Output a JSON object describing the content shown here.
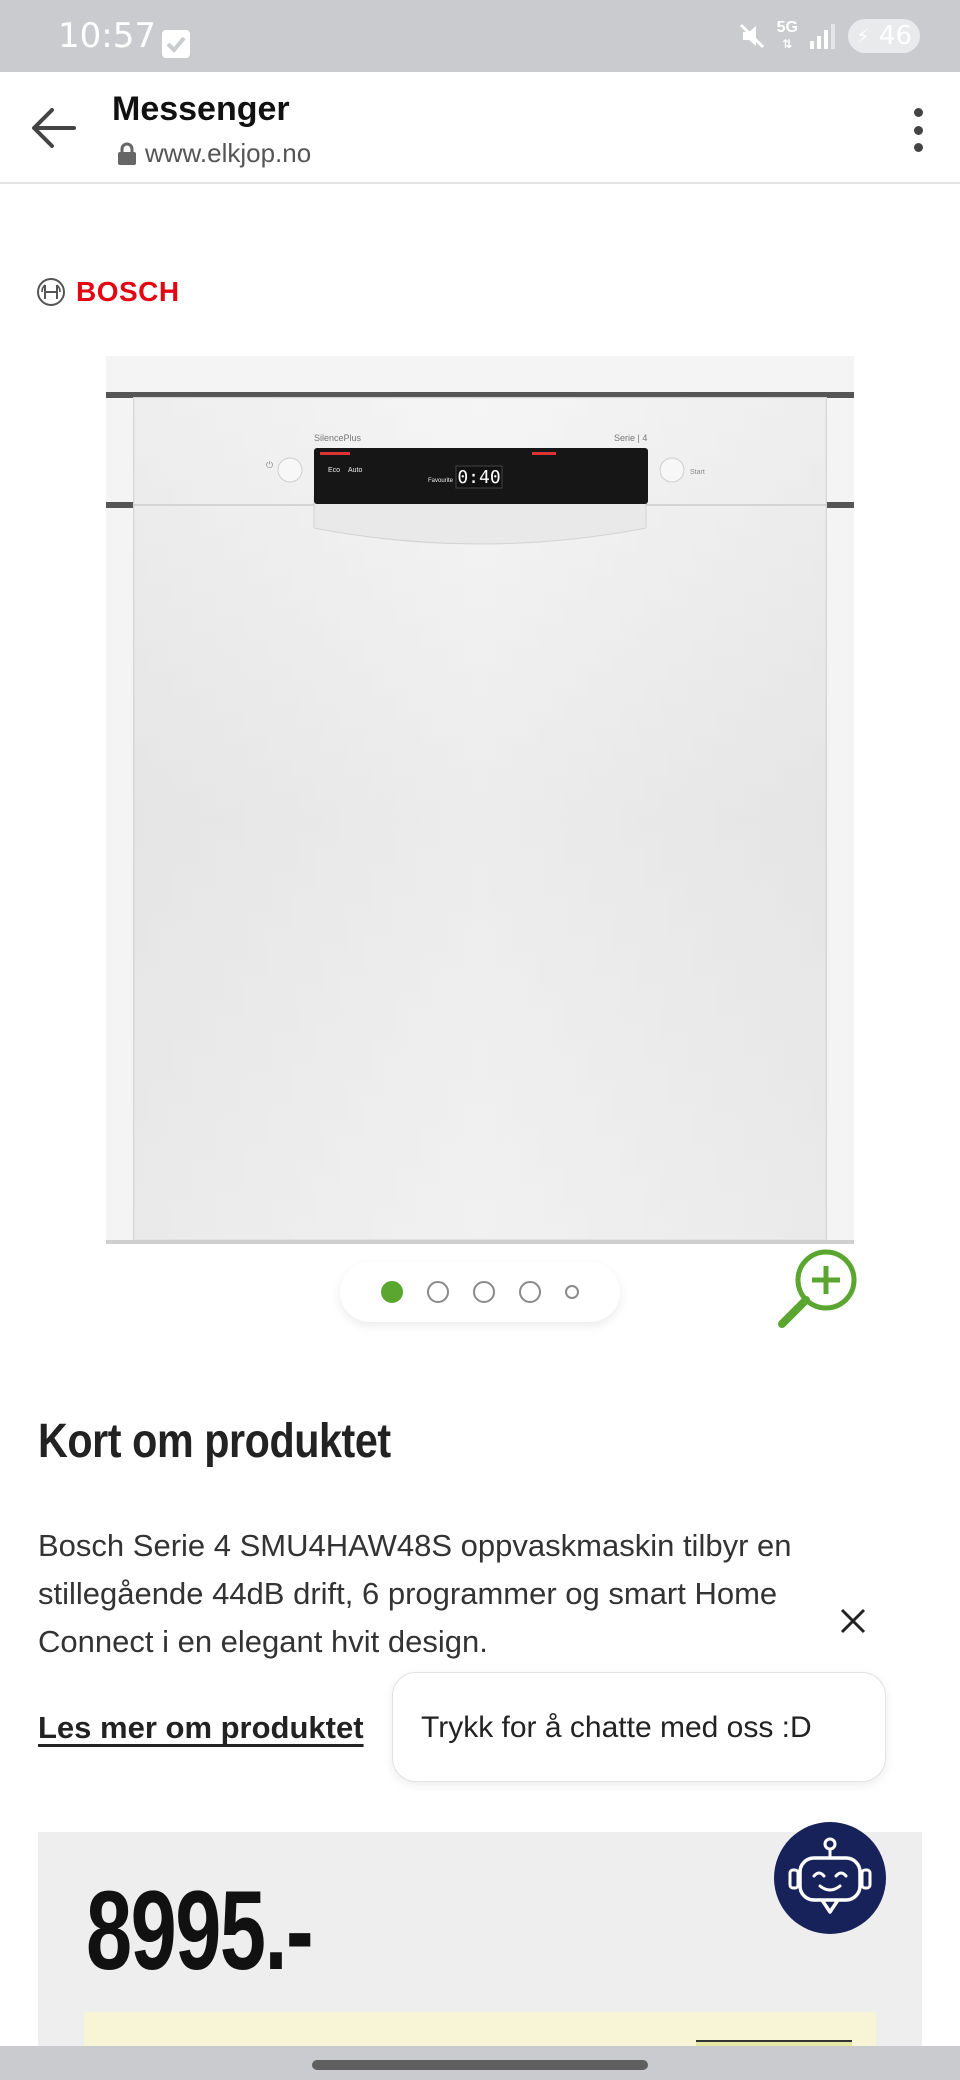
{
  "status_bar": {
    "time": "10:57",
    "network": "5G",
    "battery": "46",
    "icons": [
      "checkbox-notification-icon",
      "mute-icon",
      "signal-icon",
      "battery-saver-icon"
    ]
  },
  "browser": {
    "title": "Messenger",
    "url": "www.elkjop.no",
    "icons": [
      "back-arrow-icon",
      "lock-icon",
      "more-vert-icon"
    ]
  },
  "brand": {
    "name": "BOSCH",
    "color": "#e30613"
  },
  "product_image": {
    "panel_text": {
      "silence": "SilencePlus",
      "series": "Serie | 4",
      "display": "0:40",
      "start": "Start",
      "programs": [
        "Eco",
        "Auto",
        "Favourite"
      ]
    }
  },
  "carousel": {
    "count": 5,
    "active_index": 0,
    "accent_color": "#5aa631"
  },
  "description": {
    "title": "Kort om produktet",
    "text": "Bosch Serie 4 SMU4HAW48S oppvaskmaskin tilbyr en stillegående 44dB drift, 6 programmer og smart Home Connect i en elegant hvit design.",
    "read_more": "Les mer om produktet"
  },
  "chat": {
    "bubble_text": "Trykk for å chatte med oss :D",
    "fab_color": "#17225b"
  },
  "price": {
    "value": "8995.-"
  }
}
